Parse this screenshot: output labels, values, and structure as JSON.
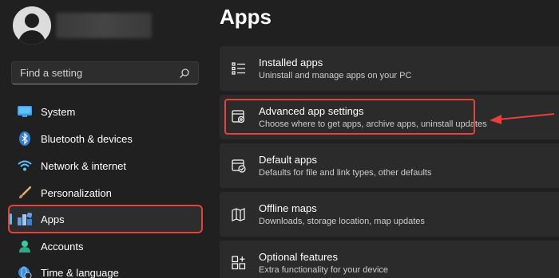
{
  "sidebar": {
    "search": {
      "placeholder": "Find a setting"
    },
    "items": [
      {
        "label": "System",
        "icon": "monitor-icon"
      },
      {
        "label": "Bluetooth & devices",
        "icon": "bluetooth-icon"
      },
      {
        "label": "Network & internet",
        "icon": "wifi-icon"
      },
      {
        "label": "Personalization",
        "icon": "brush-icon"
      },
      {
        "label": "Apps",
        "icon": "apps-icon",
        "active": true
      },
      {
        "label": "Accounts",
        "icon": "person-icon"
      },
      {
        "label": "Time & language",
        "icon": "globe-clock-icon"
      }
    ]
  },
  "main": {
    "title": "Apps",
    "cards": [
      {
        "title": "Installed apps",
        "subtitle": "Uninstall and manage apps on your PC",
        "icon": "list-icon"
      },
      {
        "title": "Advanced app settings",
        "subtitle": "Choose where to get apps, archive apps, uninstall updates",
        "icon": "app-gear-icon"
      },
      {
        "title": "Default apps",
        "subtitle": "Defaults for file and link types, other defaults",
        "icon": "default-apps-icon"
      },
      {
        "title": "Offline maps",
        "subtitle": "Downloads, storage location, map updates",
        "icon": "map-icon"
      },
      {
        "title": "Optional features",
        "subtitle": "Extra functionality for your device",
        "icon": "add-grid-icon"
      }
    ]
  },
  "colors": {
    "background": "#202020",
    "card": "#2b2b2b",
    "accent": "#4cc2ff",
    "annotation": "#e8403a"
  }
}
